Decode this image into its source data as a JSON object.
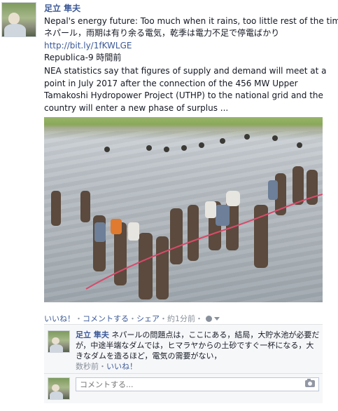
{
  "post": {
    "author": "足立 隼夫",
    "title_en": "Nepal's energy future: Too much when it rains, too little rest of the time",
    "title_ja": "ネパール，雨期は有り余る電気，乾季は電力不足で停電ばかり",
    "link": "http://bit.ly/1fKWLGE",
    "source_time": "Republica-9 時間前",
    "description": "NEA statistics say that figures of supply and demand will meet at a point in July 2017 after the connection of the 456 MW Upper Tamakoshi Hydropower Project (UTHP) to the national grid and the country will enter a new phase of surplus ..."
  },
  "actions": {
    "like": "いいね！",
    "sep1": "・",
    "comment": "コメントする",
    "sep2": "・",
    "share": "シェア",
    "time": "・約1分前・"
  },
  "comment": {
    "author": "足立 隼夫",
    "text": "ネパールの問題点は，ここにある，結局，大貯水池が必要だが，中途半端なダムでは，ヒマラヤからの土砂ですぐ一杯になる，大きなダムを造るほど，電気の需要がない，",
    "time": "数秒前",
    "sep": "・",
    "like": "いいね！"
  },
  "write_comment": {
    "placeholder": "コメントする..."
  },
  "icons": {
    "globe": "globe-icon",
    "chevron": "chevron-down-icon",
    "camera": "camera-icon"
  }
}
